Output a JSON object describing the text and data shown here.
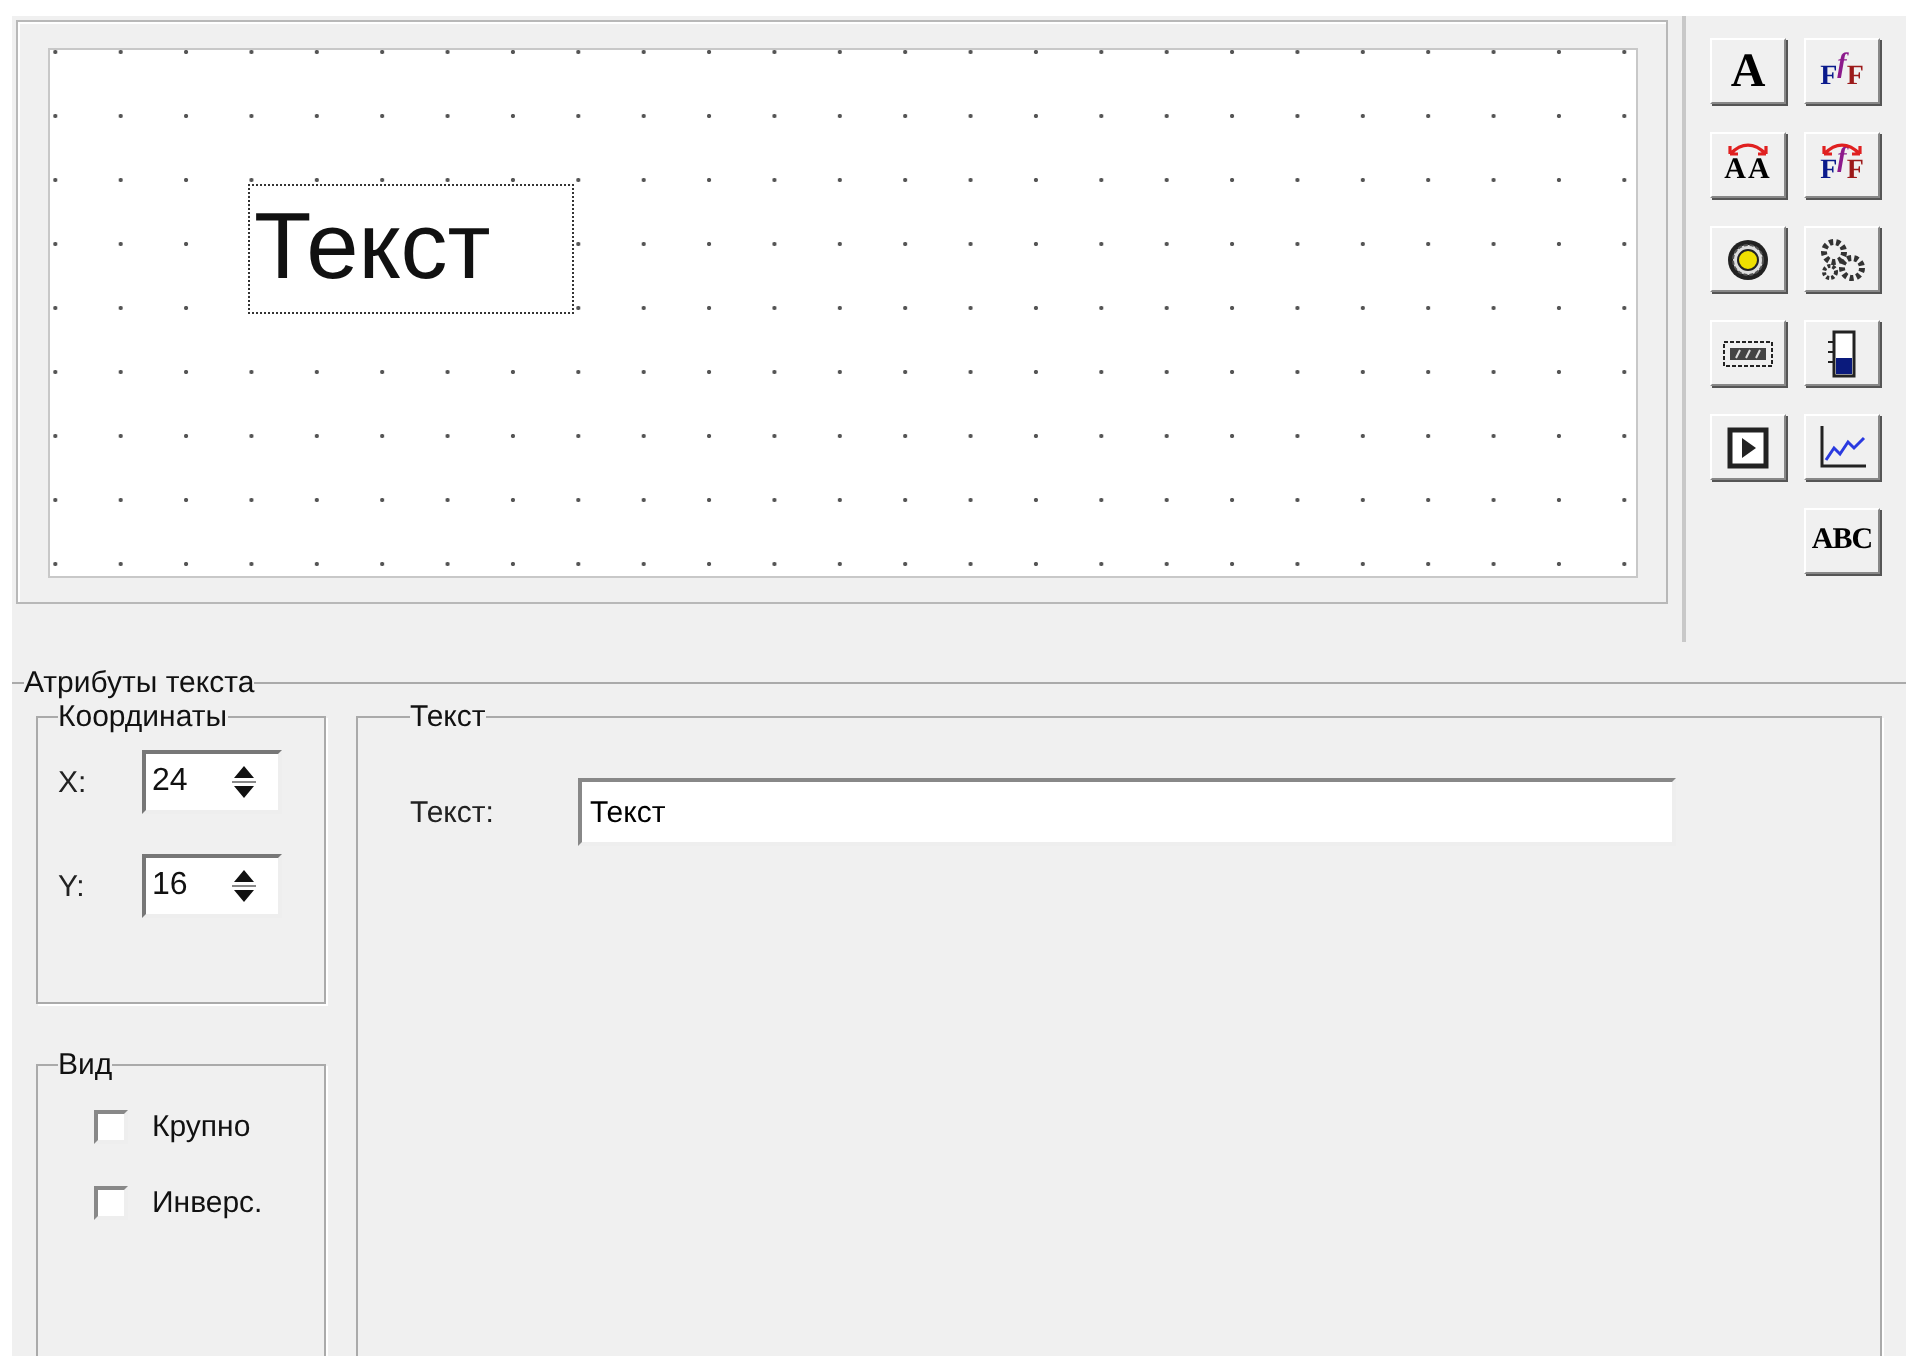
{
  "canvas": {
    "element": {
      "text": "Текст",
      "selected": true
    }
  },
  "toolbar": [
    {
      "kind": "letter",
      "label": "A"
    },
    {
      "kind": "formula",
      "label": "FfF"
    },
    {
      "kind": "swap",
      "label": "AA"
    },
    {
      "kind": "formula-swap",
      "label": "FfF"
    },
    {
      "kind": "sphere"
    },
    {
      "kind": "gears"
    },
    {
      "kind": "display"
    },
    {
      "kind": "gauge"
    },
    {
      "kind": "play"
    },
    {
      "kind": "plot"
    },
    {
      "kind": "spacer"
    },
    {
      "kind": "letter-small",
      "label": "ABC"
    }
  ],
  "attributes": {
    "title": "Атрибуты текста",
    "coordinates": {
      "title": "Координаты",
      "fields": [
        {
          "label": "X:",
          "value": "24"
        },
        {
          "label": "Y:",
          "value": "16"
        }
      ]
    },
    "view": {
      "title": "Вид",
      "options": [
        {
          "label": "Крупно",
          "checked": false
        },
        {
          "label": "Инверс.",
          "checked": false
        }
      ]
    },
    "text": {
      "title": "Текст",
      "label": "Текст:",
      "value": "Текст"
    }
  }
}
